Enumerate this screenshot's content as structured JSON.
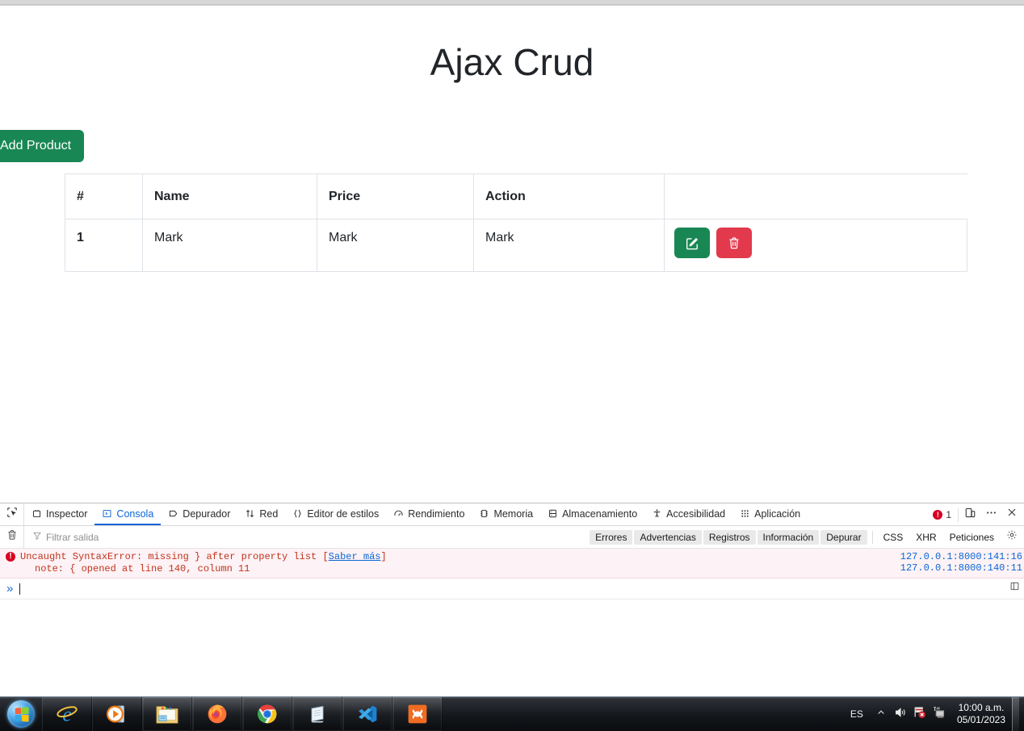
{
  "page": {
    "title": "Ajax Crud",
    "add_button": "Add Product",
    "table": {
      "headers": [
        "#",
        "Name",
        "Price",
        "Action",
        ""
      ],
      "rows": [
        {
          "index": "1",
          "name": "Mark",
          "price": "Mark",
          "action": "Mark",
          "buttons": [
            "edit-button",
            "delete-button"
          ]
        }
      ]
    },
    "colors": {
      "success": "#198754",
      "danger": "#e23a4c",
      "border": "#dee2e6"
    }
  },
  "devtools": {
    "tabs": [
      {
        "label": "Inspector",
        "icon": "inspector-icon",
        "active": false
      },
      {
        "label": "Consola",
        "icon": "console-icon",
        "active": true
      },
      {
        "label": "Depurador",
        "icon": "debugger-icon",
        "active": false
      },
      {
        "label": "Red",
        "icon": "network-icon",
        "active": false
      },
      {
        "label": "Editor de estilos",
        "icon": "style-editor-icon",
        "active": false
      },
      {
        "label": "Rendimiento",
        "icon": "performance-icon",
        "active": false
      },
      {
        "label": "Memoria",
        "icon": "memory-icon",
        "active": false
      },
      {
        "label": "Almacenamiento",
        "icon": "storage-icon",
        "active": false
      },
      {
        "label": "Accesibilidad",
        "icon": "accessibility-icon",
        "active": false
      },
      {
        "label": "Aplicación",
        "icon": "application-icon",
        "active": false
      }
    ],
    "error_count": "1",
    "filter": {
      "placeholder": "Filtrar salida",
      "buttons": [
        "Errores",
        "Advertencias",
        "Registros",
        "Información",
        "Depurar"
      ],
      "plain_buttons": [
        "CSS",
        "XHR",
        "Peticiones"
      ]
    },
    "console": {
      "message": "Uncaught SyntaxError: missing } after property list",
      "learn_more": "Saber más",
      "note": "note: { opened at line 140, column 11",
      "source_1": "127.0.0.1:8000:141:16",
      "source_2": "127.0.0.1:8000:140:11",
      "prompt": "»"
    },
    "accent": "#0a66d6",
    "error_color": "#d70022"
  },
  "taskbar": {
    "start": "start-orb",
    "items": [
      {
        "name": "internet-explorer",
        "pinned": false
      },
      {
        "name": "windows-media-player",
        "pinned": false
      },
      {
        "name": "windows-explorer",
        "pinned": true
      },
      {
        "name": "firefox",
        "pinned": true
      },
      {
        "name": "google-chrome",
        "pinned": true
      },
      {
        "name": "notepad",
        "pinned": true
      },
      {
        "name": "visual-studio-code",
        "pinned": true
      },
      {
        "name": "xampp",
        "pinned": true
      }
    ],
    "tray": {
      "language": "ES",
      "time": "10:00 a.m.",
      "date": "05/01/2023"
    }
  }
}
